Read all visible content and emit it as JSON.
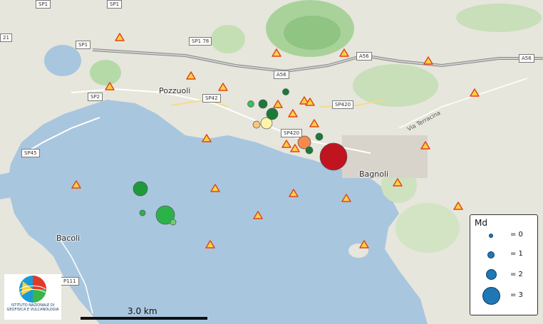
{
  "map": {
    "roads": [
      {
        "label": "SP1"
      },
      {
        "label": "SP1"
      },
      {
        "label": "SP1"
      },
      {
        "label": "SP2"
      },
      {
        "label": "SP45"
      },
      {
        "label": "SP42"
      },
      {
        "label": "SP420"
      },
      {
        "label": "SP420"
      },
      {
        "label": "SP1 78"
      },
      {
        "label": "A56"
      },
      {
        "label": "A56"
      },
      {
        "label": "A56"
      },
      {
        "label": "P111"
      },
      {
        "label": "21"
      }
    ],
    "places": [
      {
        "label": "Pozzuoli"
      },
      {
        "label": "Bagnoli"
      },
      {
        "label": "Bacoli"
      }
    ],
    "streets": [
      {
        "label": "Via Terracina"
      }
    ]
  },
  "legend": {
    "title": "Md",
    "items": [
      {
        "magnitude": 0,
        "label": "= 0"
      },
      {
        "magnitude": 1,
        "label": "= 1"
      },
      {
        "magnitude": 2,
        "label": "= 2"
      },
      {
        "magnitude": 3,
        "label": "= 3"
      }
    ],
    "marker_color": "#1f78b4"
  },
  "scale": {
    "label": "3.0 km"
  },
  "logo": {
    "caption": "ISTITUTO NAZIONALE DI GEOFISICA E VULCANOLOGIA"
  },
  "colors": {
    "sea": "#a9c6df",
    "land": "#e6e6dc",
    "station": "#ffd23f",
    "station_stroke": "#e0451f",
    "quake_dark_green": "#1a7a3a",
    "quake_green": "#2bb34a",
    "quake_pale": "#fff3a8",
    "quake_orange": "#f58a4b",
    "quake_red": "#c0141f"
  }
}
